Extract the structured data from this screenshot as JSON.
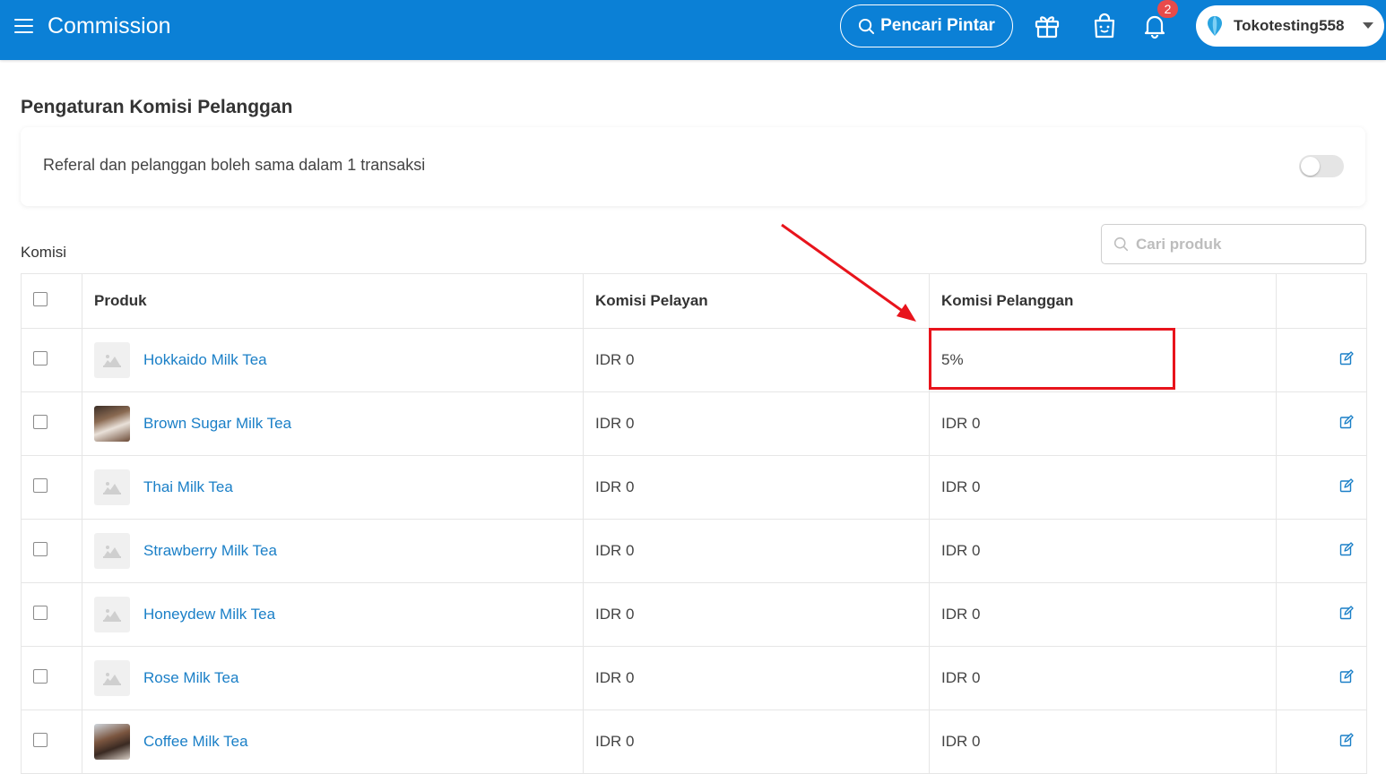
{
  "header": {
    "title": "Commission",
    "smart_search_label": "Pencari Pintar",
    "notification_count": "2",
    "account_name": "Tokotesting558",
    "bg_color": "#0b80d6"
  },
  "settings": {
    "section_title": "Pengaturan Komisi Pelanggan",
    "toggle_label": "Referal dan pelanggan boleh sama dalam 1 transaksi",
    "toggle_on": false
  },
  "komisi": {
    "label": "Komisi",
    "search_placeholder": "Cari produk",
    "columns": [
      "Produk",
      "Komisi Pelayan",
      "Komisi Pelanggan"
    ],
    "rows": [
      {
        "product": "Hokkaido Milk Tea",
        "thumb": "placeholder",
        "pelayan": "IDR 0",
        "pelanggan": "5%"
      },
      {
        "product": "Brown Sugar Milk Tea",
        "thumb": "photo",
        "pelayan": "IDR 0",
        "pelanggan": "IDR 0"
      },
      {
        "product": "Thai Milk Tea",
        "thumb": "placeholder",
        "pelayan": "IDR 0",
        "pelanggan": "IDR 0"
      },
      {
        "product": "Strawberry Milk Tea",
        "thumb": "placeholder",
        "pelayan": "IDR 0",
        "pelanggan": "IDR 0"
      },
      {
        "product": "Honeydew Milk Tea",
        "thumb": "placeholder",
        "pelayan": "IDR 0",
        "pelanggan": "IDR 0"
      },
      {
        "product": "Rose Milk Tea",
        "thumb": "placeholder",
        "pelayan": "IDR 0",
        "pelanggan": "IDR 0"
      },
      {
        "product": "Coffee Milk Tea",
        "thumb": "photo",
        "pelayan": "IDR 0",
        "pelanggan": "IDR 0"
      }
    ]
  },
  "icons": {
    "menu": "menu-icon",
    "search": "search-icon",
    "gift": "gift-icon",
    "shop": "shopping-bag-icon",
    "bell": "bell-icon",
    "location": "map-pin-icon",
    "edit": "edit-icon",
    "image_placeholder": "image-placeholder-icon"
  },
  "annotation_color": "#e8141c",
  "link_color": "#1a7fc7"
}
